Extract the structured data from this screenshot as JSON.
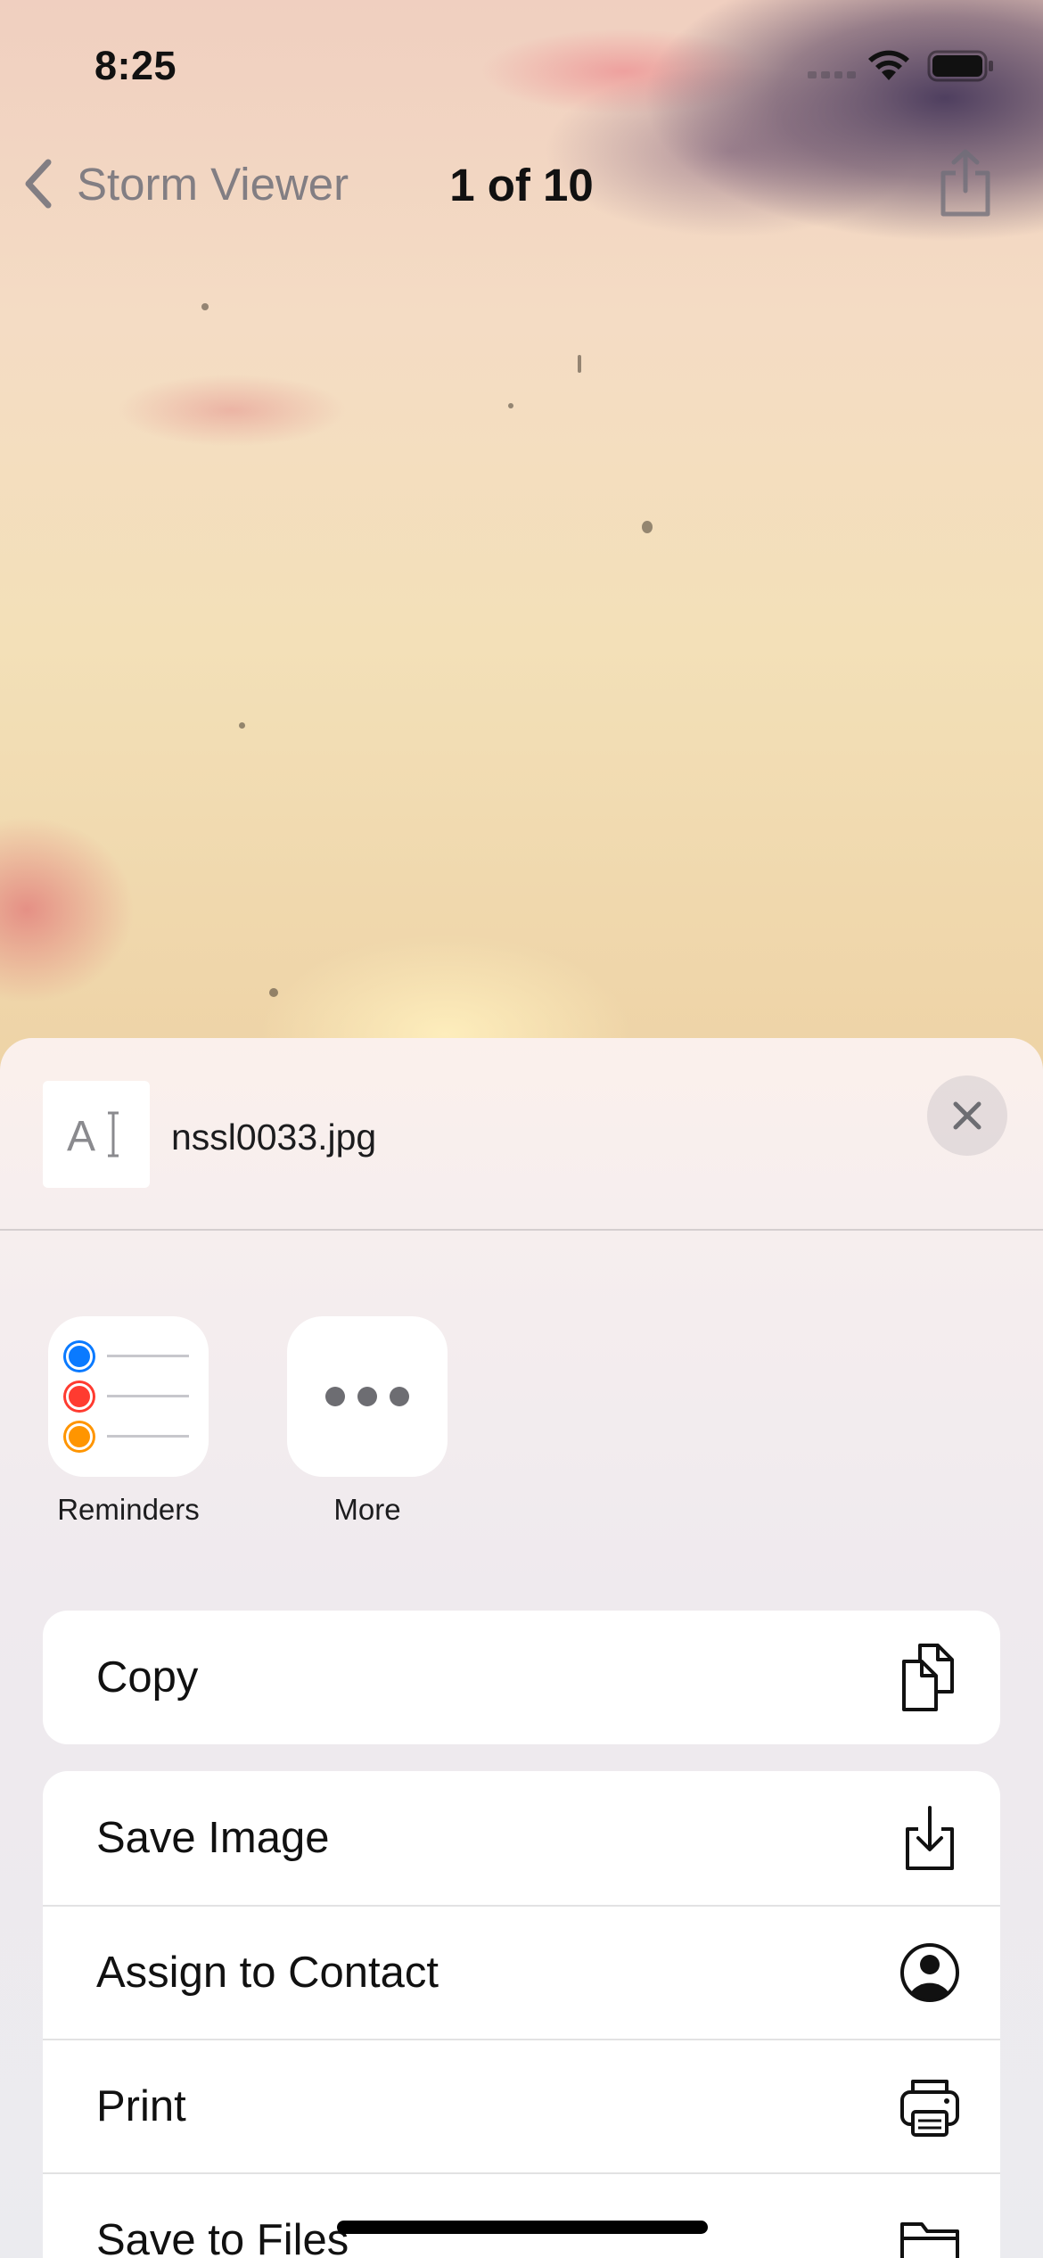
{
  "status_bar": {
    "time": "8:25"
  },
  "nav": {
    "back_label": "Storm Viewer",
    "title": "1 of 10"
  },
  "share_sheet": {
    "file_name": "nssl0033.jpg",
    "apps": [
      {
        "label": "Reminders",
        "icon": "reminders-icon"
      },
      {
        "label": "More",
        "icon": "more-icon"
      }
    ],
    "actions_group1": [
      {
        "label": "Copy",
        "icon": "copy-icon"
      }
    ],
    "actions_group2": [
      {
        "label": "Save Image",
        "icon": "save-image-icon"
      },
      {
        "label": "Assign to Contact",
        "icon": "contact-icon"
      },
      {
        "label": "Print",
        "icon": "printer-icon"
      },
      {
        "label": "Save to Files",
        "icon": "folder-icon"
      }
    ]
  },
  "colors": {
    "reminder_blue": "#0a7aff",
    "reminder_red": "#ff3b30",
    "reminder_orange": "#ff9500"
  }
}
